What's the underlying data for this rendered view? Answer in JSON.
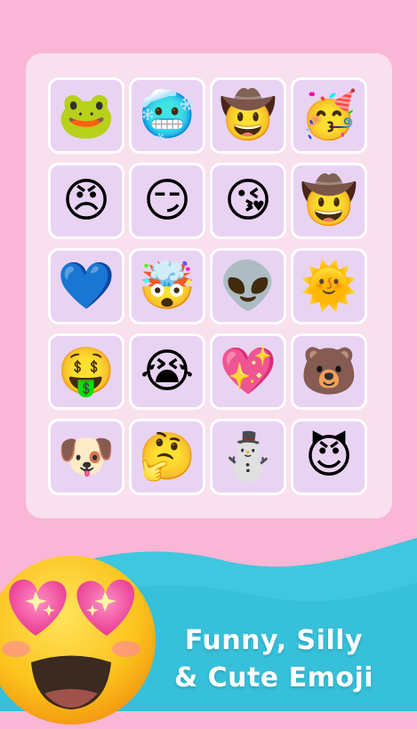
{
  "colors": {
    "background": "#f9b6d6",
    "panel": "#f9e0ef",
    "cell": "#e9d3f3",
    "wave": "#3fc7e0"
  },
  "emoji_grid": [
    {
      "name": "frog-wink-icon",
      "glyph": "🐸"
    },
    {
      "name": "cold-zipper-icon",
      "glyph": "🥶"
    },
    {
      "name": "cowboy-people-icon",
      "glyph": "🤠"
    },
    {
      "name": "party-kiss-icon",
      "glyph": "🥳"
    },
    {
      "name": "angry-melting-icon",
      "glyph": "😠"
    },
    {
      "name": "drooling-smirk-icon",
      "glyph": "😏"
    },
    {
      "name": "heart-eyes-kiss-icon",
      "glyph": "😘"
    },
    {
      "name": "cowboy-cyclops-icon",
      "glyph": "🤠"
    },
    {
      "name": "sparkle-heart-icon",
      "glyph": "💙"
    },
    {
      "name": "exploding-head-icon",
      "glyph": "🤯"
    },
    {
      "name": "alien-peace-icon",
      "glyph": "👽"
    },
    {
      "name": "sun-drool-icon",
      "glyph": "🌞"
    },
    {
      "name": "money-kiss-icon",
      "glyph": "🤑"
    },
    {
      "name": "crying-face-icon",
      "glyph": "😭"
    },
    {
      "name": "heart-tongue-icon",
      "glyph": "💖"
    },
    {
      "name": "bear-laughing-icon",
      "glyph": "🐻"
    },
    {
      "name": "frog-dog-icon",
      "glyph": "🐶"
    },
    {
      "name": "thinking-face-icon",
      "glyph": "🤔"
    },
    {
      "name": "basketball-snowman-icon",
      "glyph": "⛄"
    },
    {
      "name": "purple-lemon-icon",
      "glyph": "😈"
    }
  ],
  "hero_emoji": "star-struck-heart-eyes-icon",
  "tagline": {
    "line1": "Funny, Silly",
    "line2": "& Cute Emoji"
  }
}
